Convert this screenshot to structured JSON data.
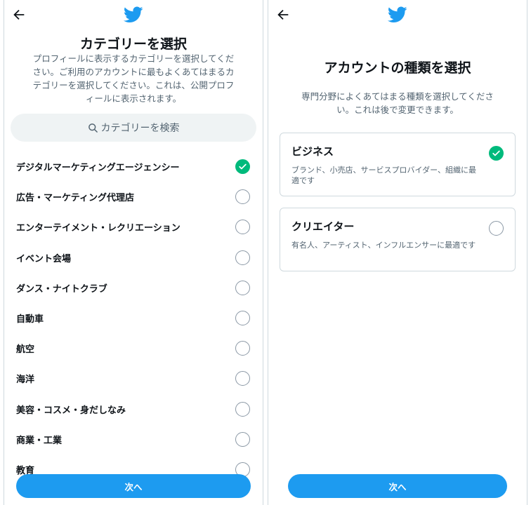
{
  "left": {
    "title": "カテゴリーを選択",
    "description": "プロフィールに表示するカテゴリーを選択してください。ご利用のアカウントに最もよくあてはまるカテゴリーを選択してください。これは、公開プロフィールに表示されます。",
    "search_placeholder": "カテゴリーを検索",
    "categories": [
      {
        "label": "デジタルマーケティングエージェンシー",
        "selected": true
      },
      {
        "label": "広告・マーケティング代理店",
        "selected": false
      },
      {
        "label": "エンターテイメント・レクリエーション",
        "selected": false
      },
      {
        "label": "イベント会場",
        "selected": false
      },
      {
        "label": "ダンス・ナイトクラブ",
        "selected": false
      },
      {
        "label": "自動車",
        "selected": false
      },
      {
        "label": "航空",
        "selected": false
      },
      {
        "label": "海洋",
        "selected": false
      },
      {
        "label": "美容・コスメ・身だしなみ",
        "selected": false
      },
      {
        "label": "商業・工業",
        "selected": false
      },
      {
        "label": "教育",
        "selected": false
      }
    ],
    "next_label": "次へ"
  },
  "right": {
    "title": "アカウントの種類を選択",
    "description": "専門分野によくあてはまる種類を選択してください。これは後で変更できます。",
    "account_types": [
      {
        "title": "ビジネス",
        "description": "ブランド、小売店、サービスプロバイダー、組織に最適です",
        "selected": true
      },
      {
        "title": "クリエイター",
        "description": "有名人、アーティスト、インフルエンサーに最適です",
        "selected": false
      }
    ],
    "next_label": "次へ"
  },
  "icons": {
    "back": "back-arrow-icon",
    "logo": "twitter-bird-icon",
    "search": "search-icon",
    "check": "check-icon"
  },
  "colors": {
    "brand": "#1d9bf0",
    "selected": "#00ba7c",
    "text": "#0f1419",
    "secondary_text": "#536471"
  }
}
